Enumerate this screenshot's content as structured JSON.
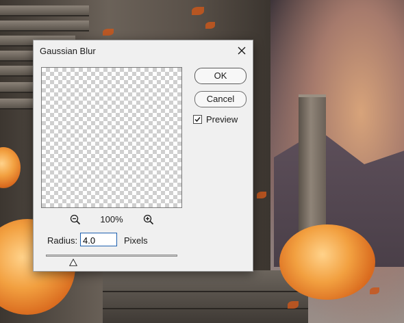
{
  "dialog": {
    "title": "Gaussian Blur",
    "ok_label": "OK",
    "cancel_label": "Cancel",
    "preview_label": "Preview",
    "preview_checked": true,
    "zoom_level": "100%",
    "radius_label": "Radius:",
    "radius_value": "4.0",
    "radius_unit": "Pixels",
    "close_icon": "close-icon",
    "zoom_out_icon": "zoom-out-icon",
    "zoom_in_icon": "zoom-in-icon",
    "slider_thumb_icon": "triangle-thumb-icon"
  },
  "colors": {
    "dialog_bg": "#f0f0f0",
    "input_focus_border": "#1c5fae",
    "checker_light": "#ffffff",
    "checker_dark": "#cfcfcf"
  }
}
